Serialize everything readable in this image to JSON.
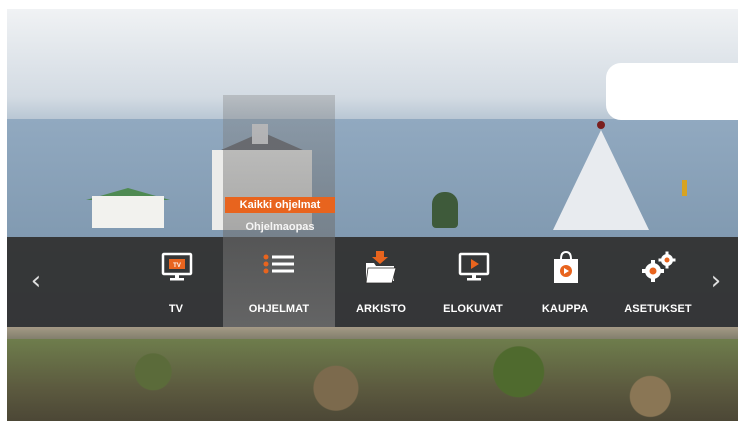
{
  "menu": {
    "items": [
      {
        "label": "TV",
        "icon": "tv-icon"
      },
      {
        "label": "OHJELMAT",
        "icon": "list-icon"
      },
      {
        "label": "ARKISTO",
        "icon": "folder-icon"
      },
      {
        "label": "ELOKUVAT",
        "icon": "movie-screen-icon"
      },
      {
        "label": "KAUPPA",
        "icon": "shopping-bag-icon"
      },
      {
        "label": "ASETUKSET",
        "icon": "gears-icon"
      }
    ],
    "selected_index": 1,
    "submenu": {
      "items": [
        "Kaikki ohjelmat",
        "Ohjelmaopas"
      ],
      "active_index": 0
    }
  },
  "icons": {
    "tv_badge": "TV"
  },
  "navigation": {
    "left_arrow": "‹",
    "right_arrow": "›"
  },
  "colors": {
    "accent": "#e8641e",
    "bar_background": "#2d2c2b",
    "text": "#ffffff"
  }
}
